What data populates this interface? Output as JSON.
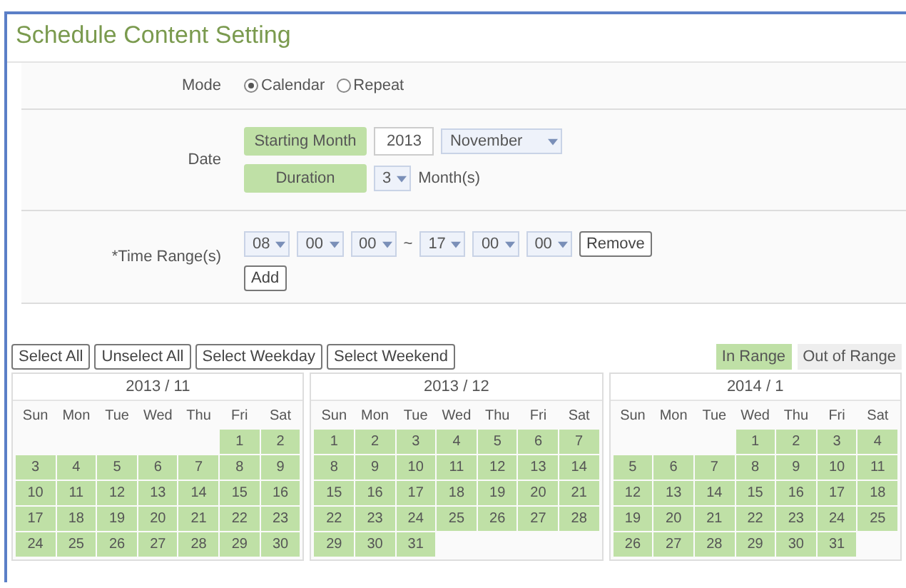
{
  "title": "Schedule Content Setting",
  "mode": {
    "label": "Mode",
    "options": [
      {
        "label": "Calendar",
        "selected": true
      },
      {
        "label": "Repeat",
        "selected": false
      }
    ]
  },
  "date": {
    "label": "Date",
    "starting_month_label": "Starting Month",
    "year": "2013",
    "month": "November",
    "duration_label": "Duration",
    "duration": "3",
    "duration_unit": "Month(s)"
  },
  "time_range": {
    "label": "*Time Range(s)",
    "start": [
      "08",
      "00",
      "00"
    ],
    "separator": "~",
    "end": [
      "17",
      "00",
      "00"
    ],
    "remove_button": "Remove",
    "add_button": "Add"
  },
  "select_buttons": [
    "Select All",
    "Unselect All",
    "Select Weekday",
    "Select Weekend"
  ],
  "legend": [
    {
      "label": "In Range",
      "in_range": true
    },
    {
      "label": "Out of Range",
      "in_range": false
    }
  ],
  "calendars": [
    {
      "title": "2013 / 11",
      "weekdays": [
        "Sun",
        "Mon",
        "Tue",
        "Wed",
        "Thu",
        "Fri",
        "Sat"
      ],
      "cells": [
        {
          "kind": "blank"
        },
        {
          "kind": "blank"
        },
        {
          "kind": "blank"
        },
        {
          "kind": "blank"
        },
        {
          "kind": "blank"
        },
        {
          "kind": "day",
          "day": "1",
          "in_range": true
        },
        {
          "kind": "day",
          "day": "2",
          "in_range": true
        },
        {
          "kind": "day",
          "day": "3",
          "in_range": true
        },
        {
          "kind": "day",
          "day": "4",
          "in_range": true
        },
        {
          "kind": "day",
          "day": "5",
          "in_range": true
        },
        {
          "kind": "day",
          "day": "6",
          "in_range": true
        },
        {
          "kind": "day",
          "day": "7",
          "in_range": true
        },
        {
          "kind": "day",
          "day": "8",
          "in_range": true
        },
        {
          "kind": "day",
          "day": "9",
          "in_range": true
        },
        {
          "kind": "day",
          "day": "10",
          "in_range": true
        },
        {
          "kind": "day",
          "day": "11",
          "in_range": true
        },
        {
          "kind": "day",
          "day": "12",
          "in_range": true
        },
        {
          "kind": "day",
          "day": "13",
          "in_range": true
        },
        {
          "kind": "day",
          "day": "14",
          "in_range": true
        },
        {
          "kind": "day",
          "day": "15",
          "in_range": true
        },
        {
          "kind": "day",
          "day": "16",
          "in_range": true
        },
        {
          "kind": "day",
          "day": "17",
          "in_range": true
        },
        {
          "kind": "day",
          "day": "18",
          "in_range": true
        },
        {
          "kind": "day",
          "day": "19",
          "in_range": true
        },
        {
          "kind": "day",
          "day": "20",
          "in_range": true
        },
        {
          "kind": "day",
          "day": "21",
          "in_range": true
        },
        {
          "kind": "day",
          "day": "22",
          "in_range": true
        },
        {
          "kind": "day",
          "day": "23",
          "in_range": true
        },
        {
          "kind": "day",
          "day": "24",
          "in_range": true
        },
        {
          "kind": "day",
          "day": "25",
          "in_range": true
        },
        {
          "kind": "day",
          "day": "26",
          "in_range": true
        },
        {
          "kind": "day",
          "day": "27",
          "in_range": true
        },
        {
          "kind": "day",
          "day": "28",
          "in_range": true
        },
        {
          "kind": "day",
          "day": "29",
          "in_range": true
        },
        {
          "kind": "day",
          "day": "30",
          "in_range": true
        }
      ]
    },
    {
      "title": "2013 / 12",
      "weekdays": [
        "Sun",
        "Mon",
        "Tue",
        "Wed",
        "Thu",
        "Fri",
        "Sat"
      ],
      "cells": [
        {
          "kind": "day",
          "day": "1",
          "in_range": true
        },
        {
          "kind": "day",
          "day": "2",
          "in_range": true
        },
        {
          "kind": "day",
          "day": "3",
          "in_range": true
        },
        {
          "kind": "day",
          "day": "4",
          "in_range": true
        },
        {
          "kind": "day",
          "day": "5",
          "in_range": true
        },
        {
          "kind": "day",
          "day": "6",
          "in_range": true
        },
        {
          "kind": "day",
          "day": "7",
          "in_range": true
        },
        {
          "kind": "day",
          "day": "8",
          "in_range": true
        },
        {
          "kind": "day",
          "day": "9",
          "in_range": true
        },
        {
          "kind": "day",
          "day": "10",
          "in_range": true
        },
        {
          "kind": "day",
          "day": "11",
          "in_range": true
        },
        {
          "kind": "day",
          "day": "12",
          "in_range": true
        },
        {
          "kind": "day",
          "day": "13",
          "in_range": true
        },
        {
          "kind": "day",
          "day": "14",
          "in_range": true
        },
        {
          "kind": "day",
          "day": "15",
          "in_range": true
        },
        {
          "kind": "day",
          "day": "16",
          "in_range": true
        },
        {
          "kind": "day",
          "day": "17",
          "in_range": true
        },
        {
          "kind": "day",
          "day": "18",
          "in_range": true
        },
        {
          "kind": "day",
          "day": "19",
          "in_range": true
        },
        {
          "kind": "day",
          "day": "20",
          "in_range": true
        },
        {
          "kind": "day",
          "day": "21",
          "in_range": true
        },
        {
          "kind": "day",
          "day": "22",
          "in_range": true
        },
        {
          "kind": "day",
          "day": "23",
          "in_range": true
        },
        {
          "kind": "day",
          "day": "24",
          "in_range": true
        },
        {
          "kind": "day",
          "day": "25",
          "in_range": true
        },
        {
          "kind": "day",
          "day": "26",
          "in_range": true
        },
        {
          "kind": "day",
          "day": "27",
          "in_range": true
        },
        {
          "kind": "day",
          "day": "28",
          "in_range": true
        },
        {
          "kind": "day",
          "day": "29",
          "in_range": true
        },
        {
          "kind": "day",
          "day": "30",
          "in_range": true
        },
        {
          "kind": "day",
          "day": "31",
          "in_range": true
        }
      ]
    },
    {
      "title": "2014 / 1",
      "weekdays": [
        "Sun",
        "Mon",
        "Tue",
        "Wed",
        "Thu",
        "Fri",
        "Sat"
      ],
      "cells": [
        {
          "kind": "blank"
        },
        {
          "kind": "blank"
        },
        {
          "kind": "blank"
        },
        {
          "kind": "day",
          "day": "1",
          "in_range": true
        },
        {
          "kind": "day",
          "day": "2",
          "in_range": true
        },
        {
          "kind": "day",
          "day": "3",
          "in_range": true
        },
        {
          "kind": "day",
          "day": "4",
          "in_range": true
        },
        {
          "kind": "day",
          "day": "5",
          "in_range": true
        },
        {
          "kind": "day",
          "day": "6",
          "in_range": true
        },
        {
          "kind": "day",
          "day": "7",
          "in_range": true
        },
        {
          "kind": "day",
          "day": "8",
          "in_range": true
        },
        {
          "kind": "day",
          "day": "9",
          "in_range": true
        },
        {
          "kind": "day",
          "day": "10",
          "in_range": true
        },
        {
          "kind": "day",
          "day": "11",
          "in_range": true
        },
        {
          "kind": "day",
          "day": "12",
          "in_range": true
        },
        {
          "kind": "day",
          "day": "13",
          "in_range": true
        },
        {
          "kind": "day",
          "day": "14",
          "in_range": true
        },
        {
          "kind": "day",
          "day": "15",
          "in_range": true
        },
        {
          "kind": "day",
          "day": "16",
          "in_range": true
        },
        {
          "kind": "day",
          "day": "17",
          "in_range": true
        },
        {
          "kind": "day",
          "day": "18",
          "in_range": true
        },
        {
          "kind": "day",
          "day": "19",
          "in_range": true
        },
        {
          "kind": "day",
          "day": "20",
          "in_range": true
        },
        {
          "kind": "day",
          "day": "21",
          "in_range": true
        },
        {
          "kind": "day",
          "day": "22",
          "in_range": true
        },
        {
          "kind": "day",
          "day": "23",
          "in_range": true
        },
        {
          "kind": "day",
          "day": "24",
          "in_range": true
        },
        {
          "kind": "day",
          "day": "25",
          "in_range": true
        },
        {
          "kind": "day",
          "day": "26",
          "in_range": true
        },
        {
          "kind": "day",
          "day": "27",
          "in_range": true
        },
        {
          "kind": "day",
          "day": "28",
          "in_range": true
        },
        {
          "kind": "day",
          "day": "29",
          "in_range": true
        },
        {
          "kind": "day",
          "day": "30",
          "in_range": true
        },
        {
          "kind": "day",
          "day": "31",
          "in_range": true
        }
      ]
    }
  ]
}
